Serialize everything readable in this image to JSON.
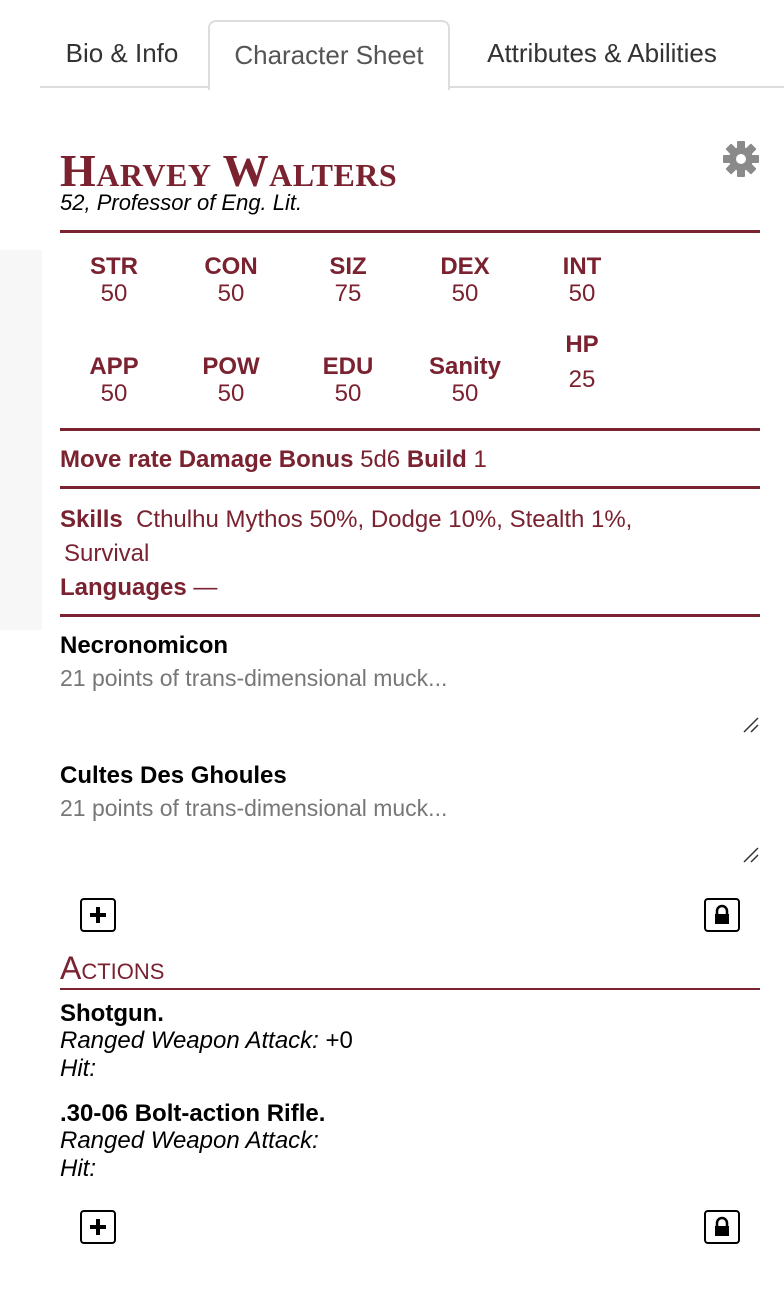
{
  "tabs": [
    {
      "label": "Bio & Info"
    },
    {
      "label": "Character Sheet"
    },
    {
      "label": "Attributes & Abilities"
    }
  ],
  "character": {
    "name": "Harvey Walters",
    "subtitle": "52, Professor of Eng. Lit."
  },
  "stats_row1": [
    {
      "label": "STR",
      "value": "50"
    },
    {
      "label": "CON",
      "value": "50"
    },
    {
      "label": "SIZ",
      "value": "75"
    },
    {
      "label": "DEX",
      "value": "50"
    },
    {
      "label": "INT",
      "value": "50"
    }
  ],
  "stats_row2": [
    {
      "label": "APP",
      "value": "50"
    },
    {
      "label": "POW",
      "value": "50"
    },
    {
      "label": "EDU",
      "value": "50"
    },
    {
      "label": "Sanity",
      "value": "50"
    },
    {
      "label": "HP",
      "value": "25"
    }
  ],
  "movement": {
    "move_label": "Move rate",
    "damage_label": "Damage Bonus",
    "damage_value": "5d6",
    "build_label": "Build",
    "build_value": "1"
  },
  "skills": {
    "label": "Skills",
    "line1": "Cthulhu Mythos 50%, Dodge 10%, Stealth 1%,",
    "line2": "Survival"
  },
  "languages": {
    "label": "Languages",
    "value": "—"
  },
  "traits": [
    {
      "title": "Necronomicon",
      "desc": "21 points of trans-dimensional muck..."
    },
    {
      "title": "Cultes Des Ghoules",
      "desc": "21 points of trans-dimensional muck..."
    }
  ],
  "actions": {
    "heading": "Actions",
    "items": [
      {
        "name": "Shotgun.",
        "attack_label": "Ranged Weapon Attack:",
        "attack_value": " +0",
        "hit_label": "Hit:"
      },
      {
        "name": ".30-06 Bolt-action Rifle.",
        "attack_label": "Ranged Weapon Attack:",
        "attack_value": "",
        "hit_label": "Hit:"
      }
    ]
  },
  "colors": {
    "accent": "#7a2230",
    "muted": "#777777",
    "border": "#dddddd"
  },
  "icons": [
    "gear-icon",
    "add-icon",
    "lock-icon",
    "resize-handle-icon"
  ]
}
